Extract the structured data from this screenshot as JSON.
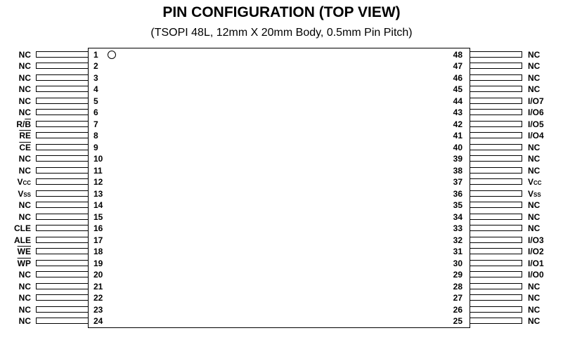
{
  "title": "PIN CONFIGURATION (TOP VIEW)",
  "subtitle": "(TSOPI 48L, 12mm X 20mm Body, 0.5mm Pin Pitch)",
  "pin1_marker": "circle",
  "left_pins": [
    {
      "num": "1",
      "pre": "NC",
      "bar": ""
    },
    {
      "num": "2",
      "pre": "NC",
      "bar": ""
    },
    {
      "num": "3",
      "pre": "NC",
      "bar": ""
    },
    {
      "num": "4",
      "pre": "NC",
      "bar": ""
    },
    {
      "num": "5",
      "pre": "NC",
      "bar": ""
    },
    {
      "num": "6",
      "pre": "NC",
      "bar": ""
    },
    {
      "num": "7",
      "pre": "R/",
      "bar": "B"
    },
    {
      "num": "8",
      "pre": "",
      "bar": "RE"
    },
    {
      "num": "9",
      "pre": "",
      "bar": "CE"
    },
    {
      "num": "10",
      "pre": "NC",
      "bar": ""
    },
    {
      "num": "11",
      "pre": "NC",
      "bar": ""
    },
    {
      "num": "12",
      "pre": "Vcc",
      "bar": ""
    },
    {
      "num": "13",
      "pre": "Vss",
      "bar": ""
    },
    {
      "num": "14",
      "pre": "NC",
      "bar": ""
    },
    {
      "num": "15",
      "pre": "NC",
      "bar": ""
    },
    {
      "num": "16",
      "pre": "CLE",
      "bar": ""
    },
    {
      "num": "17",
      "pre": "ALE",
      "bar": ""
    },
    {
      "num": "18",
      "pre": "",
      "bar": "WE"
    },
    {
      "num": "19",
      "pre": "",
      "bar": "WP"
    },
    {
      "num": "20",
      "pre": "NC",
      "bar": ""
    },
    {
      "num": "21",
      "pre": "NC",
      "bar": ""
    },
    {
      "num": "22",
      "pre": "NC",
      "bar": ""
    },
    {
      "num": "23",
      "pre": "NC",
      "bar": ""
    },
    {
      "num": "24",
      "pre": "NC",
      "bar": ""
    }
  ],
  "right_pins": [
    {
      "num": "48",
      "pre": "NC",
      "bar": ""
    },
    {
      "num": "47",
      "pre": "NC",
      "bar": ""
    },
    {
      "num": "46",
      "pre": "NC",
      "bar": ""
    },
    {
      "num": "45",
      "pre": "NC",
      "bar": ""
    },
    {
      "num": "44",
      "pre": "I/O7",
      "bar": ""
    },
    {
      "num": "43",
      "pre": "I/O6",
      "bar": ""
    },
    {
      "num": "42",
      "pre": "I/O5",
      "bar": ""
    },
    {
      "num": "41",
      "pre": "I/O4",
      "bar": ""
    },
    {
      "num": "40",
      "pre": "NC",
      "bar": ""
    },
    {
      "num": "39",
      "pre": "NC",
      "bar": ""
    },
    {
      "num": "38",
      "pre": "NC",
      "bar": ""
    },
    {
      "num": "37",
      "pre": "Vcc",
      "bar": ""
    },
    {
      "num": "36",
      "pre": "Vss",
      "bar": ""
    },
    {
      "num": "35",
      "pre": "NC",
      "bar": ""
    },
    {
      "num": "34",
      "pre": "NC",
      "bar": ""
    },
    {
      "num": "33",
      "pre": "NC",
      "bar": ""
    },
    {
      "num": "32",
      "pre": "I/O3",
      "bar": ""
    },
    {
      "num": "31",
      "pre": "I/O2",
      "bar": ""
    },
    {
      "num": "30",
      "pre": "I/O1",
      "bar": ""
    },
    {
      "num": "29",
      "pre": "I/O0",
      "bar": ""
    },
    {
      "num": "28",
      "pre": "NC",
      "bar": ""
    },
    {
      "num": "27",
      "pre": "NC",
      "bar": ""
    },
    {
      "num": "26",
      "pre": "NC",
      "bar": ""
    },
    {
      "num": "25",
      "pre": "NC",
      "bar": ""
    }
  ]
}
